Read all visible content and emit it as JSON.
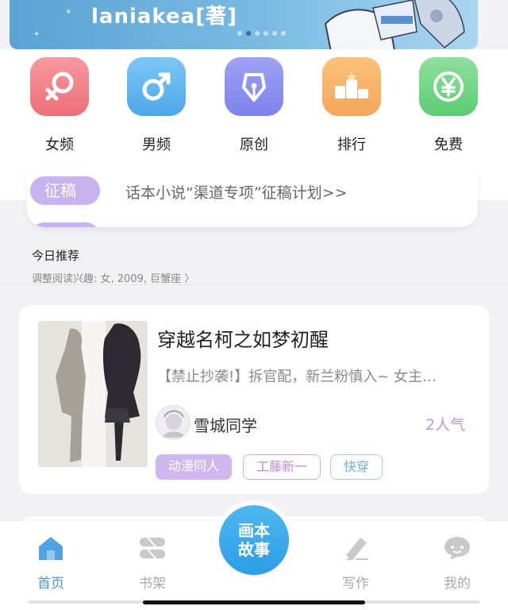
{
  "banner": {
    "text": "laniakea[著]",
    "dots": 6,
    "active_dot": 1
  },
  "categories": [
    {
      "label": "女频",
      "icon": "female-icon",
      "color_top": "#f59a9e",
      "color_bottom": "#ee6e78"
    },
    {
      "label": "男频",
      "icon": "male-icon",
      "color_top": "#7cc6f4",
      "color_bottom": "#4ea8ea"
    },
    {
      "label": "原创",
      "icon": "pen-nib-icon",
      "color_top": "#9fa2f5",
      "color_bottom": "#7d82ec"
    },
    {
      "label": "排行",
      "icon": "podium-icon",
      "color_top": "#fbc27a",
      "color_bottom": "#f5a65a"
    },
    {
      "label": "免费",
      "icon": "yen-icon",
      "color_top": "#8fe09c",
      "color_bottom": "#5ccc74"
    }
  ],
  "notice": {
    "badge": "征稿",
    "text": "话本小说“渠道专项”征稿计划>>"
  },
  "recommend": {
    "title": "今日推荐",
    "subtitle": "调整阅读兴趣: 女, 2009, 巨蟹座 〉"
  },
  "book": {
    "title": "穿越名柯之如梦初醒",
    "description": "【禁止抄袭!】拆官配，新兰粉慎入~ 女主…",
    "author": "雪城同学",
    "popularity": "2人气",
    "tags": [
      "动漫同人",
      "工藤新一",
      "快穿"
    ]
  },
  "nav": {
    "items": [
      {
        "label": "首页",
        "icon": "home-icon",
        "active": true
      },
      {
        "label": "书架",
        "icon": "bookshelf-icon",
        "active": false
      },
      {
        "label": "写作",
        "icon": "write-icon",
        "active": false
      },
      {
        "label": "我的",
        "icon": "profile-chat-icon",
        "active": false
      }
    ],
    "center_line1": "画本",
    "center_line2": "故事"
  },
  "colors": {
    "accent_blue": "#4a93d8",
    "badge_purple": "#c8b2ef",
    "popularity_purple": "#b79ae6"
  }
}
